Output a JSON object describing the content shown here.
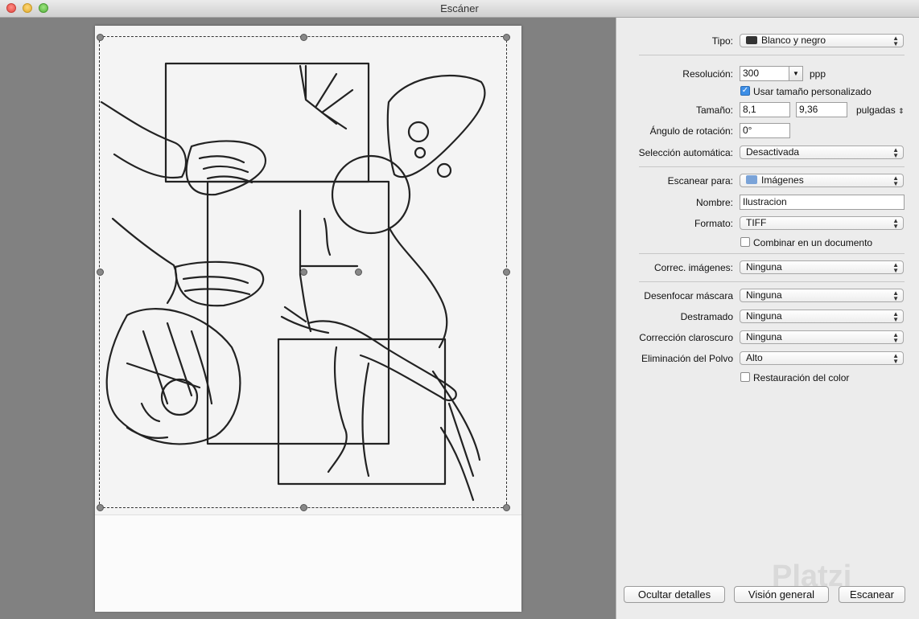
{
  "window": {
    "title": "Escáner"
  },
  "settings": {
    "tipo": {
      "label": "Tipo:",
      "value": "Blanco y negro",
      "icon": "bw-image-icon"
    },
    "resolucion": {
      "label": "Resolución:",
      "value": "300",
      "unit": "ppp"
    },
    "usar_tamano": {
      "label": "Usar tamaño personalizado",
      "checked": true
    },
    "tamano": {
      "label": "Tamaño:",
      "width": "8,1",
      "height": "9,36",
      "unit": "pulgadas"
    },
    "angulo": {
      "label": "Ángulo de rotación:",
      "value": "0°"
    },
    "seleccion": {
      "label": "Selección automática:",
      "value": "Desactivada"
    },
    "escanear_para": {
      "label": "Escanear para:",
      "value": "Imágenes",
      "icon": "folder-icon"
    },
    "nombre": {
      "label": "Nombre:",
      "value": "Ilustracion"
    },
    "formato": {
      "label": "Formato:",
      "value": "TIFF"
    },
    "combinar": {
      "label": "Combinar en un documento",
      "checked": false
    },
    "correc": {
      "label": "Correc. imágenes:",
      "value": "Ninguna"
    },
    "desenfocar": {
      "label": "Desenfocar máscara",
      "value": "Ninguna"
    },
    "destramado": {
      "label": "Destramado",
      "value": "Ninguna"
    },
    "claroscuro": {
      "label": "Corrección claroscuro",
      "value": "Ninguna"
    },
    "polvo": {
      "label": "Eliminación del Polvo",
      "value": "Alto"
    },
    "restauracion": {
      "label": "Restauración del color",
      "checked": false
    }
  },
  "buttons": {
    "ocultar": "Ocultar detalles",
    "vision": "Visión general",
    "escanear": "Escanear"
  },
  "watermark": "Platzi",
  "colors": {
    "preview_bg": "#818181",
    "accent": "#3d8ee6"
  }
}
